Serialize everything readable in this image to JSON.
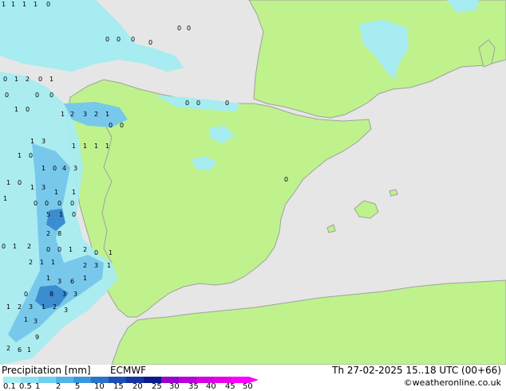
{
  "title_left": "Precipitation [mm]",
  "model": "ECMWF",
  "valid_time": "Th 27-02-2025 15..18 UTC (00+66)",
  "credit": "©weatheronline.co.uk",
  "colors": {
    "sea": "#e6e6e6",
    "land": "#bff28c",
    "coast": "#a0a0a0",
    "precip_light": "#a6ecf0",
    "precip_mid": "#78c8ec",
    "precip_heavy": "#3c8cd2"
  },
  "legend": {
    "labels": [
      "0.1",
      "0.5",
      "1",
      "2",
      "5",
      "10",
      "15",
      "20",
      "25",
      "30",
      "35",
      "40",
      "45",
      "50"
    ],
    "colors": [
      "#a6ecf0",
      "#8ee0f0",
      "#70d0f0",
      "#50b4e8",
      "#3c96dc",
      "#2a74c8",
      "#1e50b4",
      "#1434a0",
      "#0a1a8c",
      "#9a00c8",
      "#b800d8",
      "#d400e0",
      "#e800e8",
      "#ff00ff"
    ]
  },
  "map_values": [
    {
      "v": "1"
    },
    {
      "v": "1"
    },
    {
      "v": "1"
    },
    {
      "v": "1"
    },
    {
      "v": "0"
    },
    {
      "v": "0"
    },
    {
      "v": "1"
    },
    {
      "v": "2"
    },
    {
      "v": "0"
    },
    {
      "v": "1"
    },
    {
      "v": "0"
    },
    {
      "v": "0"
    },
    {
      "v": "0"
    },
    {
      "v": "1"
    },
    {
      "v": "0"
    },
    {
      "v": "1"
    },
    {
      "v": "2"
    },
    {
      "v": "3"
    },
    {
      "v": "2"
    },
    {
      "v": "1"
    },
    {
      "v": "0"
    },
    {
      "v": "0"
    },
    {
      "v": "1"
    },
    {
      "v": "3"
    },
    {
      "v": "1"
    },
    {
      "v": "1"
    },
    {
      "v": "1"
    },
    {
      "v": "1"
    },
    {
      "v": "1"
    },
    {
      "v": "0"
    },
    {
      "v": "1"
    },
    {
      "v": "0"
    },
    {
      "v": "4"
    },
    {
      "v": "3"
    },
    {
      "v": "1"
    },
    {
      "v": "0"
    },
    {
      "v": "1"
    },
    {
      "v": "3"
    },
    {
      "v": "1"
    },
    {
      "v": "1"
    },
    {
      "v": "1"
    },
    {
      "v": "0"
    },
    {
      "v": "0"
    },
    {
      "v": "0"
    },
    {
      "v": "0"
    },
    {
      "v": "5"
    },
    {
      "v": "1"
    },
    {
      "v": "0"
    },
    {
      "v": "2"
    },
    {
      "v": "8"
    },
    {
      "v": "0"
    },
    {
      "v": "1"
    },
    {
      "v": "2"
    },
    {
      "v": "0"
    },
    {
      "v": "0"
    },
    {
      "v": "1"
    },
    {
      "v": "2"
    },
    {
      "v": "0"
    },
    {
      "v": "1"
    },
    {
      "v": "2"
    },
    {
      "v": "1"
    },
    {
      "v": "1"
    },
    {
      "v": "2"
    },
    {
      "v": "3"
    },
    {
      "v": "1"
    },
    {
      "v": "1"
    },
    {
      "v": "3"
    },
    {
      "v": "6"
    },
    {
      "v": "1"
    },
    {
      "v": "0"
    },
    {
      "v": "8"
    },
    {
      "v": "3"
    },
    {
      "v": "3"
    },
    {
      "v": "1"
    },
    {
      "v": "2"
    },
    {
      "v": "3"
    },
    {
      "v": "1"
    },
    {
      "v": "2"
    },
    {
      "v": "3"
    },
    {
      "v": "1"
    },
    {
      "v": "3"
    },
    {
      "v": "9"
    },
    {
      "v": "2"
    },
    {
      "v": "6"
    },
    {
      "v": "1"
    },
    {
      "v": "0"
    },
    {
      "v": "0"
    },
    {
      "v": "0"
    },
    {
      "v": "0"
    },
    {
      "v": "0"
    },
    {
      "v": "0"
    },
    {
      "v": "0"
    },
    {
      "v": "0"
    },
    {
      "v": "0"
    },
    {
      "v": "0"
    }
  ]
}
